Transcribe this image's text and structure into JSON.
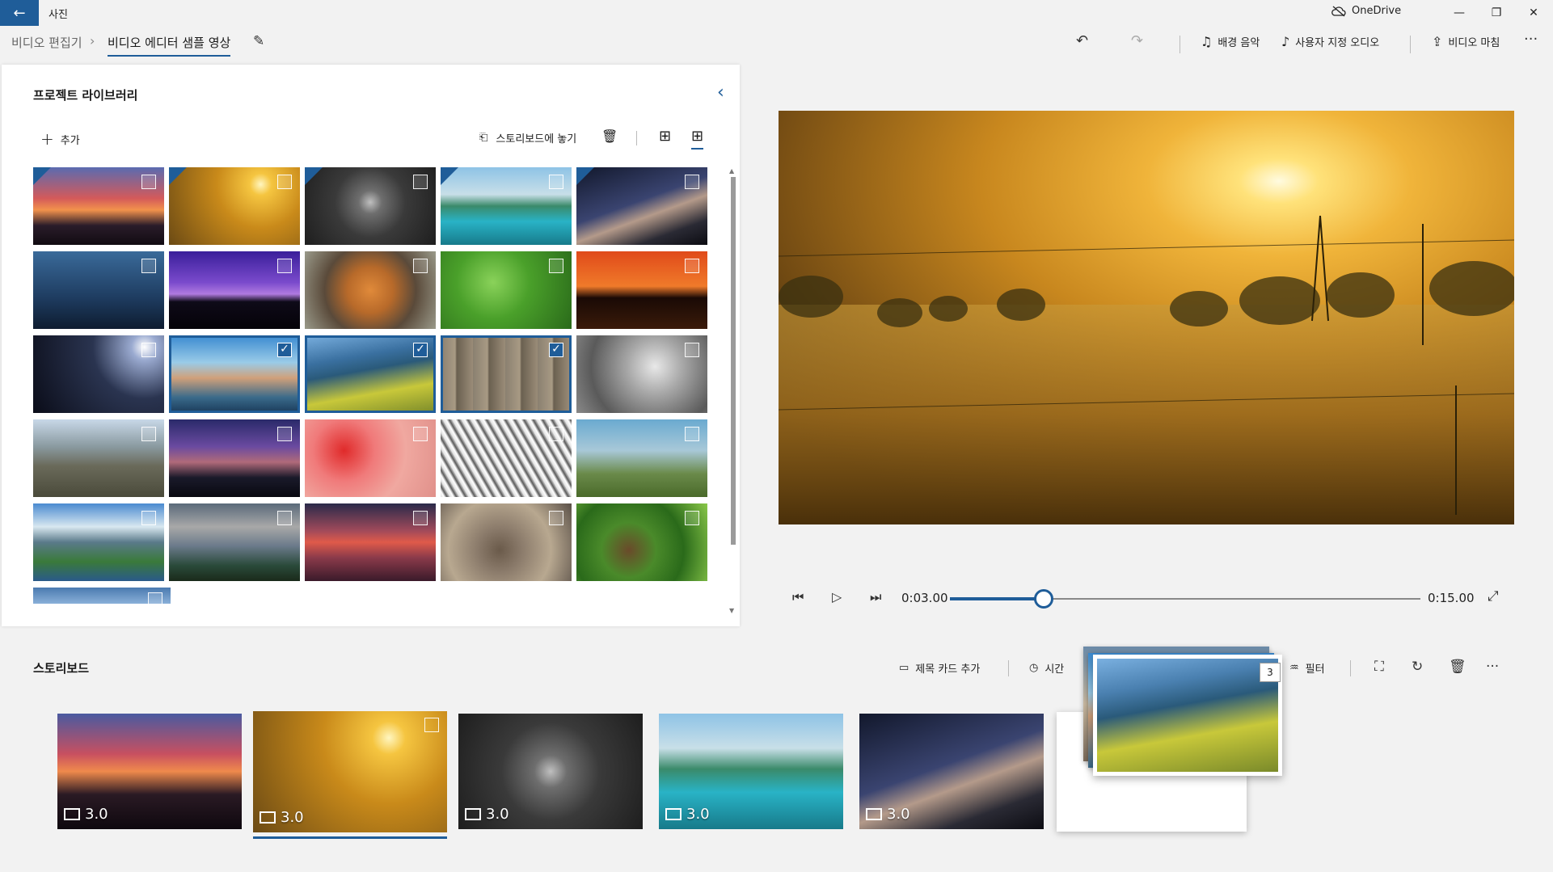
{
  "titlebar": {
    "app_title": "사진",
    "onedrive": "OneDrive"
  },
  "breadcrumb": {
    "root": "비디오 편집기",
    "current": "비디오 에디터 샘플 영상"
  },
  "toolbar": {
    "bg_music": "배경 음악",
    "custom_audio": "사용자 지정 오디오",
    "finish_video": "비디오 마침"
  },
  "library": {
    "title": "프로젝트 라이브러리",
    "add": "추가",
    "place_storyboard": "스토리보드에 놓기"
  },
  "playback": {
    "current_time": "0:03.00",
    "total_time": "0:15.00",
    "progress": 0.2
  },
  "storyboard": {
    "label": "스토리보드",
    "add_title_card": "제목 카드 추가",
    "duration": "시간",
    "filters": "필터",
    "drag_count": "3",
    "cards": [
      {
        "duration": "3.0"
      },
      {
        "duration": "3.0"
      },
      {
        "duration": "3.0"
      },
      {
        "duration": "3.0"
      },
      {
        "duration": "3.0"
      }
    ]
  },
  "colors": {
    "accent": "#1f5d99"
  }
}
